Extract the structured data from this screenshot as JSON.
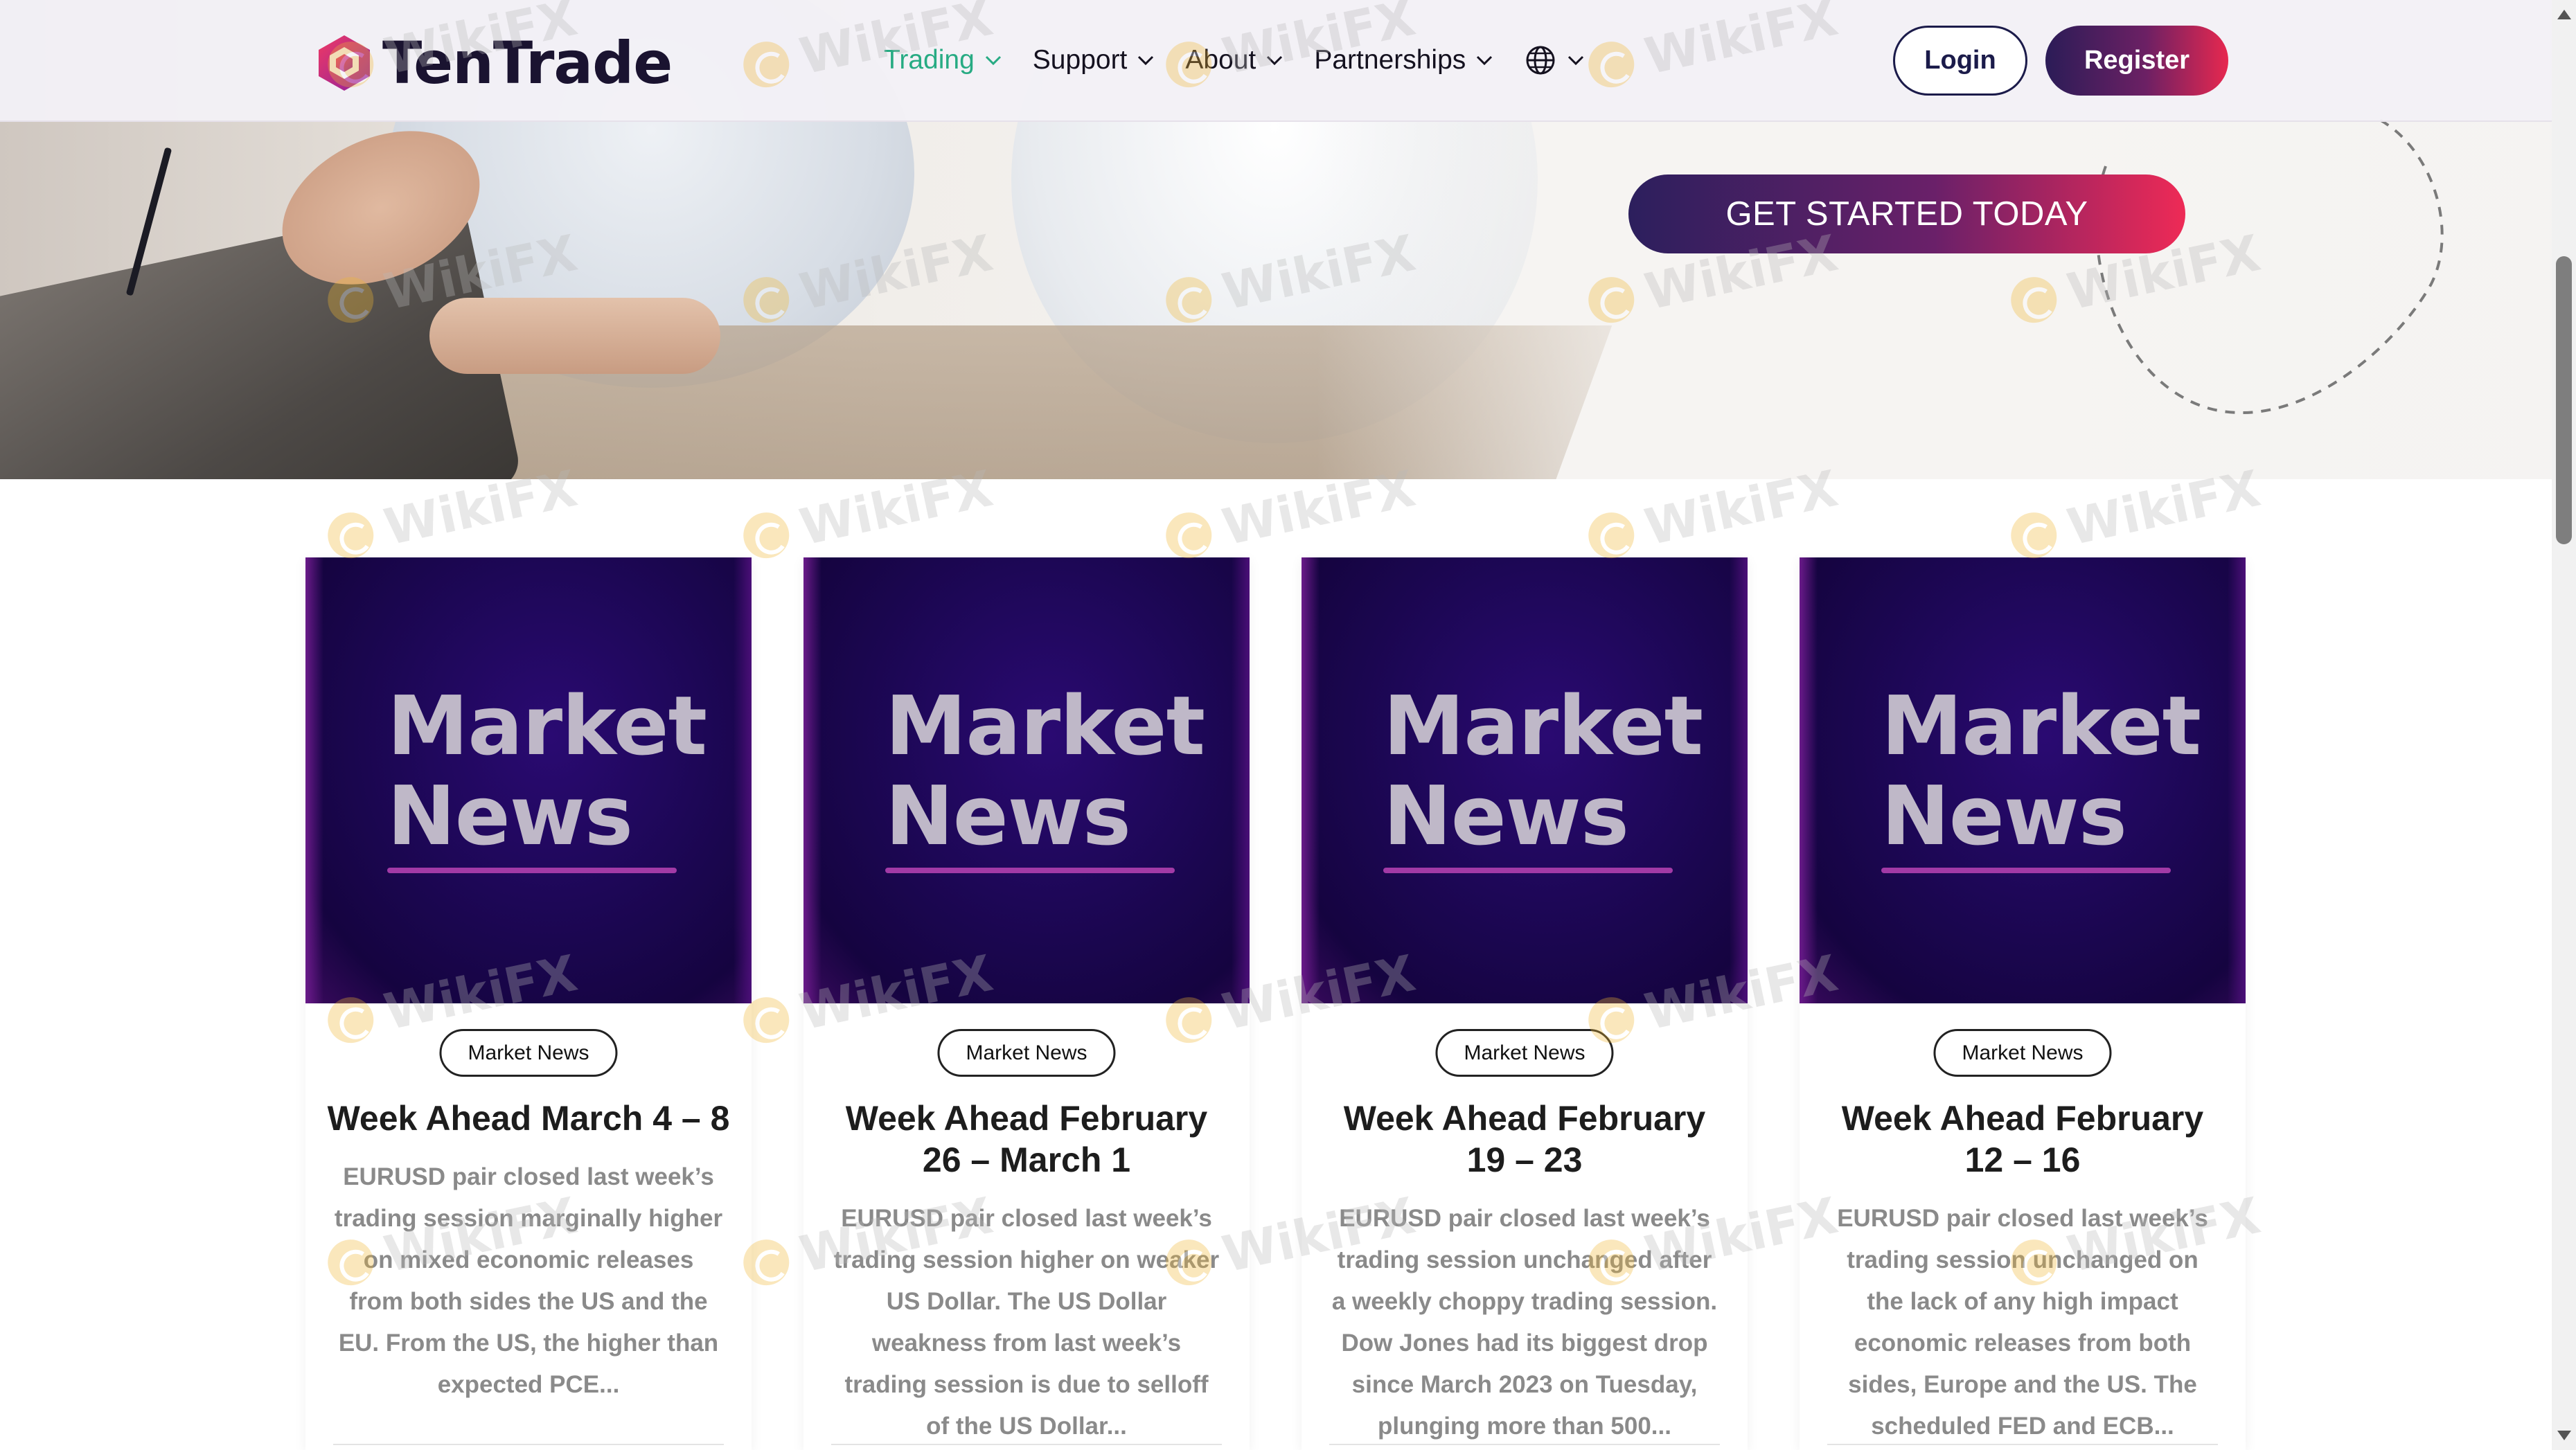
{
  "header": {
    "logo_text": "TenTrade",
    "nav": [
      {
        "label": "Trading",
        "active": true
      },
      {
        "label": "Support",
        "active": false
      },
      {
        "label": "About",
        "active": false
      },
      {
        "label": "Partnerships",
        "active": false
      }
    ],
    "language_icon": "globe-icon",
    "login_label": "Login",
    "register_label": "Register"
  },
  "hero": {
    "cta_label": "GET STARTED TODAY"
  },
  "cards": [
    {
      "thumb_line1": "Market",
      "thumb_line2": "News",
      "badge": "Market News",
      "title": "Week Ahead March 4 – 8",
      "excerpt": "EURUSD pair closed last week’s trading session marginally higher on mixed economic releases from both sides the US and the EU. From the US, the higher than expected PCE..."
    },
    {
      "thumb_line1": "Market",
      "thumb_line2": "News",
      "badge": "Market News",
      "title": "Week Ahead February 26 – March 1",
      "excerpt": "EURUSD pair closed last week’s trading session higher on weaker US Dollar. The US Dollar weakness from last week’s trading session is due to selloff of the US Dollar..."
    },
    {
      "thumb_line1": "Market",
      "thumb_line2": "News",
      "badge": "Market News",
      "title": "Week Ahead February 19 – 23",
      "excerpt": "EURUSD pair closed last week’s trading session unchanged after a weekly choppy trading session. Dow Jones had its biggest drop since March 2023 on Tuesday, plunging more than 500..."
    },
    {
      "thumb_line1": "Market",
      "thumb_line2": "News",
      "badge": "Market News",
      "title": "Week Ahead February 12 – 16",
      "excerpt": "EURUSD pair closed last week’s trading session unchanged on the lack of any high impact economic releases from both sides, Europe and the US. The scheduled FED and ECB..."
    }
  ],
  "watermark": {
    "text": "WikiFX"
  },
  "colors": {
    "active_nav": "#27ab83",
    "brand_dark": "#1b1b4a",
    "gradient_start": "#2b1c57",
    "gradient_end": "#e7284f",
    "card_thumb": "#1d0756"
  }
}
